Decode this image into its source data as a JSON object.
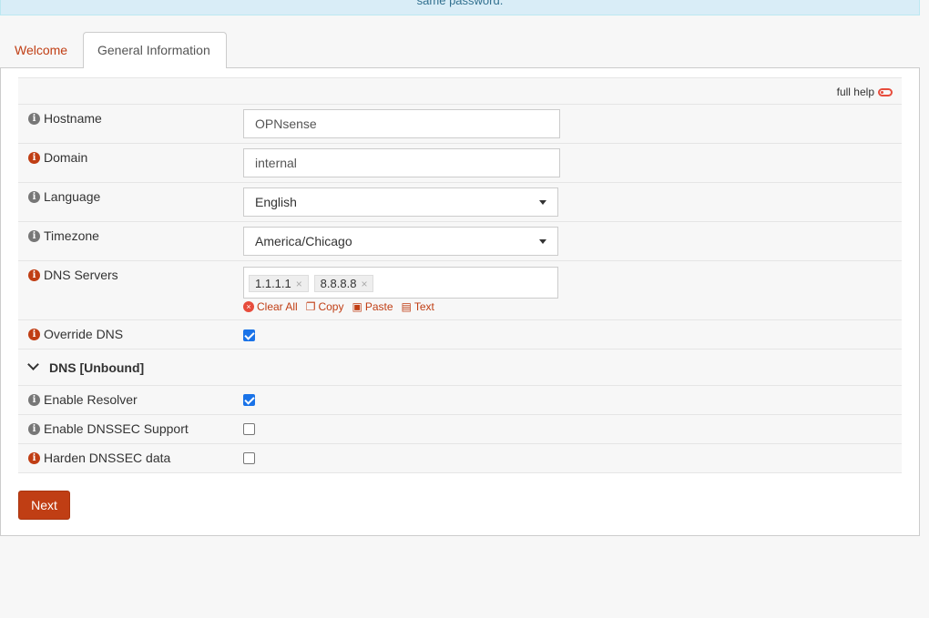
{
  "notice": {
    "text": "same password."
  },
  "tabs": [
    {
      "label": "Welcome"
    },
    {
      "label": "General Information"
    }
  ],
  "help": {
    "label": "full help",
    "icon": "toggle-off-icon"
  },
  "fields": {
    "hostname": {
      "label": "Hostname",
      "value": "OPNsense"
    },
    "domain": {
      "label": "Domain",
      "value": "internal"
    },
    "language": {
      "label": "Language",
      "value": "English"
    },
    "timezone": {
      "label": "Timezone",
      "value": "America/Chicago"
    },
    "dns_servers": {
      "label": "DNS Servers",
      "tokens": [
        "1.1.1.1",
        "8.8.8.8"
      ],
      "actions": {
        "clear": "Clear All",
        "copy": "Copy",
        "paste": "Paste",
        "text": "Text"
      }
    },
    "override_dns": {
      "label": "Override DNS",
      "checked": true
    }
  },
  "section": {
    "title": "DNS [Unbound]"
  },
  "unbound": {
    "enable_resolver": {
      "label": "Enable Resolver",
      "checked": true
    },
    "enable_dnssec": {
      "label": "Enable DNSSEC Support",
      "checked": false
    },
    "harden_dnssec": {
      "label": "Harden DNSSEC data",
      "checked": false
    }
  },
  "buttons": {
    "next": "Next"
  },
  "colors": {
    "accent": "#c03e14",
    "checkbox": "#1a73e8",
    "info_gray": "#777777"
  }
}
